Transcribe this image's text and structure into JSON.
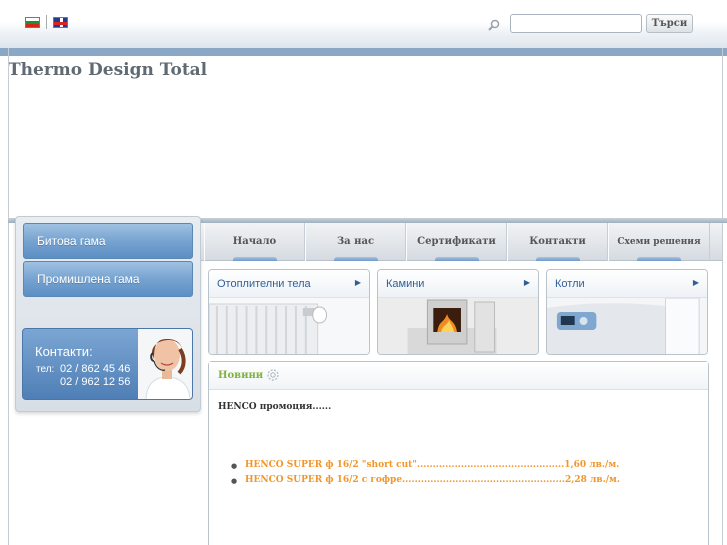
{
  "topbar": {
    "languages": [
      {
        "code": "bg",
        "icon": "bulgarian-flag-icon"
      },
      {
        "code": "en",
        "icon": "uk-flag-icon"
      }
    ],
    "search": {
      "placeholder": "",
      "value": "",
      "button_label": "Търси"
    }
  },
  "header": {
    "site_title": "Thermo Design Total"
  },
  "sidebar": {
    "buttons": [
      {
        "label": "Битова гама"
      },
      {
        "label": "Промишлена гама"
      }
    ],
    "contact": {
      "title": "Контакти:",
      "tel_label": "тел:",
      "phones": [
        "02 / 862 45 46",
        "02 / 962 12 56"
      ]
    }
  },
  "nav": {
    "items": [
      {
        "label": "Начало"
      },
      {
        "label": "За нас"
      },
      {
        "label": "Сертификати"
      },
      {
        "label": "Контакти"
      },
      {
        "label": "Схеми решения"
      }
    ]
  },
  "products": [
    {
      "label": "Отоплителни тела"
    },
    {
      "label": "Камини"
    },
    {
      "label": "Котли"
    }
  ],
  "news": {
    "title": "Новини",
    "intro": "HENCO промоция......",
    "items": [
      {
        "text": "HENCO SUPER ф 16/2 \"short cut\"...............................................1,60 лв./м."
      },
      {
        "text": "HENCO SUPER ф 16/2  с гофре....................................................2,28 лв./м."
      }
    ]
  },
  "colors": {
    "accent_blue": "#5d8fc4",
    "news_title": "#7fb23f",
    "promo_orange": "#f0962a",
    "link_blue": "#2f5f96"
  }
}
